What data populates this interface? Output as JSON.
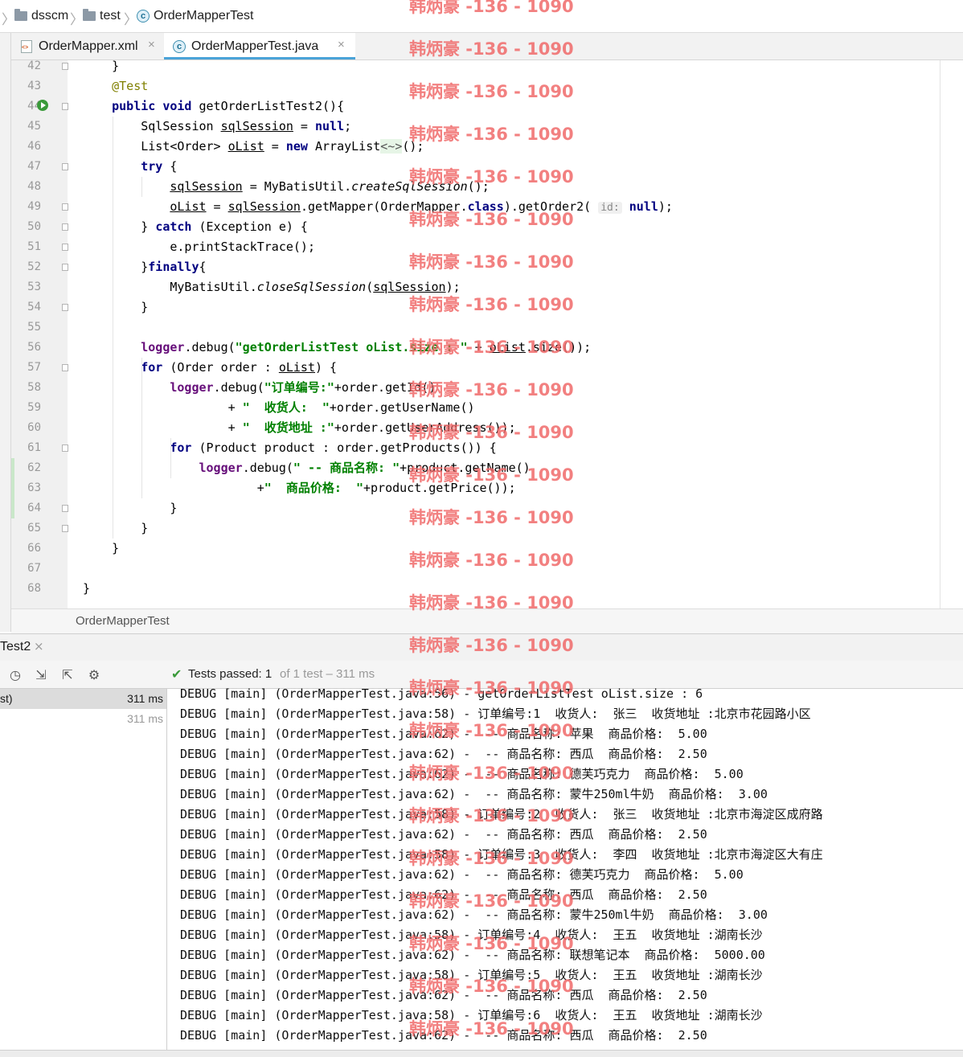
{
  "breadcrumb": {
    "items": [
      "dsscm",
      "test",
      "OrderMapperTest"
    ]
  },
  "tabs": [
    {
      "label": "OrderMapper.xml",
      "close": "×"
    },
    {
      "label": "OrderMapperTest.java",
      "close": "×"
    }
  ],
  "editor": {
    "line_numbers": [
      "42",
      "43",
      "44",
      "45",
      "46",
      "47",
      "48",
      "49",
      "50",
      "51",
      "52",
      "53",
      "54",
      "55",
      "56",
      "57",
      "58",
      "59",
      "60",
      "61",
      "62",
      "63",
      "64",
      "65",
      "66",
      "67",
      "68"
    ],
    "lines": [
      [
        {
          "t": "    }"
        }
      ],
      [
        {
          "t": "    "
        },
        {
          "t": "@Test",
          "c": "ann"
        }
      ],
      [
        {
          "t": "    "
        },
        {
          "t": "public",
          "c": "kw"
        },
        {
          "t": " "
        },
        {
          "t": "void",
          "c": "kw"
        },
        {
          "t": " getOrderListTest2(){"
        }
      ],
      [
        {
          "t": "        SqlSession "
        },
        {
          "t": "sqlSession",
          "c": "ul"
        },
        {
          "t": " = "
        },
        {
          "t": "null",
          "c": "kw"
        },
        {
          "t": ";"
        }
      ],
      [
        {
          "t": "        List<Order> "
        },
        {
          "t": "oList",
          "c": "ul"
        },
        {
          "t": " = "
        },
        {
          "t": "new",
          "c": "kw"
        },
        {
          "t": " ArrayList"
        },
        {
          "t": "<~>",
          "c": "diam"
        },
        {
          "t": "();"
        }
      ],
      [
        {
          "t": "        "
        },
        {
          "t": "try",
          "c": "kw"
        },
        {
          "t": " {"
        }
      ],
      [
        {
          "t": "            "
        },
        {
          "t": "sqlSession",
          "c": "ul"
        },
        {
          "t": " = MyBatisUtil."
        },
        {
          "t": "createSqlSession",
          "c": "ital"
        },
        {
          "t": "();"
        }
      ],
      [
        {
          "t": "            "
        },
        {
          "t": "oList",
          "c": "ul"
        },
        {
          "t": " = "
        },
        {
          "t": "sqlSession",
          "c": "ul"
        },
        {
          "t": ".getMapper(OrderMapper."
        },
        {
          "t": "class",
          "c": "kw"
        },
        {
          "t": ").getOrder2( "
        },
        {
          "t": "id:",
          "c": "hint"
        },
        {
          "t": " "
        },
        {
          "t": "null",
          "c": "kw"
        },
        {
          "t": ");"
        }
      ],
      [
        {
          "t": "        } "
        },
        {
          "t": "catch",
          "c": "kw"
        },
        {
          "t": " (Exception e) {"
        }
      ],
      [
        {
          "t": "            e.printStackTrace();"
        }
      ],
      [
        {
          "t": "        }"
        },
        {
          "t": "finally",
          "c": "kw"
        },
        {
          "t": "{"
        }
      ],
      [
        {
          "t": "            MyBatisUtil."
        },
        {
          "t": "closeSqlSession",
          "c": "ital"
        },
        {
          "t": "("
        },
        {
          "t": "sqlSession",
          "c": "ul"
        },
        {
          "t": ");"
        }
      ],
      [
        {
          "t": "        }"
        }
      ],
      [
        {
          "t": ""
        }
      ],
      [
        {
          "t": "        "
        },
        {
          "t": "logger",
          "c": "fld"
        },
        {
          "t": ".debug("
        },
        {
          "t": "\"getOrderListTest oList.size : \"",
          "c": "str"
        },
        {
          "t": " + "
        },
        {
          "t": "oList",
          "c": "ul"
        },
        {
          "t": ".size());"
        }
      ],
      [
        {
          "t": "        "
        },
        {
          "t": "for",
          "c": "kw"
        },
        {
          "t": " (Order order : "
        },
        {
          "t": "oList",
          "c": "ul"
        },
        {
          "t": ") {"
        }
      ],
      [
        {
          "t": "            "
        },
        {
          "t": "logger",
          "c": "fld"
        },
        {
          "t": ".debug("
        },
        {
          "t": "\"订单编号:\"",
          "c": "str"
        },
        {
          "t": "+order.getId()"
        }
      ],
      [
        {
          "t": "                    + "
        },
        {
          "t": "\"  收货人:  \"",
          "c": "str"
        },
        {
          "t": "+order.getUserName()"
        }
      ],
      [
        {
          "t": "                    + "
        },
        {
          "t": "\"  收货地址 :\"",
          "c": "str"
        },
        {
          "t": "+order.getUserAddress());"
        }
      ],
      [
        {
          "t": "            "
        },
        {
          "t": "for",
          "c": "kw"
        },
        {
          "t": " (Product product : order.getProducts()) {"
        }
      ],
      [
        {
          "t": "                "
        },
        {
          "t": "logger",
          "c": "fld"
        },
        {
          "t": ".debug("
        },
        {
          "t": "\" -- 商品名称: \"",
          "c": "str"
        },
        {
          "t": "+product.getName()"
        }
      ],
      [
        {
          "t": "                        +"
        },
        {
          "t": "\"  商品价格:  \"",
          "c": "str"
        },
        {
          "t": "+product.getPrice());"
        }
      ],
      [
        {
          "t": "            }"
        }
      ],
      [
        {
          "t": "        }"
        }
      ],
      [
        {
          "t": "    }"
        }
      ],
      [
        {
          "t": ""
        }
      ],
      [
        {
          "t": "}"
        }
      ]
    ]
  },
  "editor_footer": {
    "label": "OrderMapperTest"
  },
  "run_panel": {
    "tab_label": "Test2",
    "tab_close": "×",
    "status_check": "✔",
    "status_passed": "Tests passed: 1",
    "status_rest": "of 1 test – 311 ms",
    "tree": [
      {
        "name": "st)",
        "time": "311 ms"
      },
      {
        "name": "",
        "time": "311 ms"
      }
    ],
    "console": [
      "DEBUG [main] (OrderMapperTest.java:56) - getOrderListTest oList.size : 6",
      "DEBUG [main] (OrderMapperTest.java:58) - 订单编号:1  收货人:  张三  收货地址 :北京市花园路小区",
      "DEBUG [main] (OrderMapperTest.java:62) -  -- 商品名称: 苹果  商品价格:  5.00",
      "DEBUG [main] (OrderMapperTest.java:62) -  -- 商品名称: 西瓜  商品价格:  2.50",
      "DEBUG [main] (OrderMapperTest.java:62) -  -- 商品名称: 德芙巧克力  商品价格:  5.00",
      "DEBUG [main] (OrderMapperTest.java:62) -  -- 商品名称: 蒙牛250ml牛奶  商品价格:  3.00",
      "DEBUG [main] (OrderMapperTest.java:58) - 订单编号:2  收货人:  张三  收货地址 :北京市海淀区成府路",
      "DEBUG [main] (OrderMapperTest.java:62) -  -- 商品名称: 西瓜  商品价格:  2.50",
      "DEBUG [main] (OrderMapperTest.java:58) - 订单编号:3  收货人:  李四  收货地址 :北京市海淀区大有庄",
      "DEBUG [main] (OrderMapperTest.java:62) -  -- 商品名称: 德芙巧克力  商品价格:  5.00",
      "DEBUG [main] (OrderMapperTest.java:62) -  -- 商品名称: 西瓜  商品价格:  2.50",
      "DEBUG [main] (OrderMapperTest.java:62) -  -- 商品名称: 蒙牛250ml牛奶  商品价格:  3.00",
      "DEBUG [main] (OrderMapperTest.java:58) - 订单编号:4  收货人:  王五  收货地址 :湖南长沙",
      "DEBUG [main] (OrderMapperTest.java:62) -  -- 商品名称: 联想笔记本  商品价格:  5000.00",
      "DEBUG [main] (OrderMapperTest.java:58) - 订单编号:5  收货人:  王五  收货地址 :湖南长沙",
      "DEBUG [main] (OrderMapperTest.java:62) -  -- 商品名称: 西瓜  商品价格:  2.50",
      "DEBUG [main] (OrderMapperTest.java:58) - 订单编号:6  收货人:  王五  收货地址 :湖南长沙",
      "DEBUG [main] (OrderMapperTest.java:62) -  -- 商品名称: 西瓜  商品价格:  2.50"
    ]
  },
  "watermark": {
    "text": "韩炳豪 -136 - 1090",
    "count": 25,
    "color": "#f06a6a"
  },
  "colors": {
    "keyword": "#000080",
    "string": "#008000",
    "annotation": "#808000",
    "field": "#660e7a",
    "success": "#3a9a3a"
  }
}
